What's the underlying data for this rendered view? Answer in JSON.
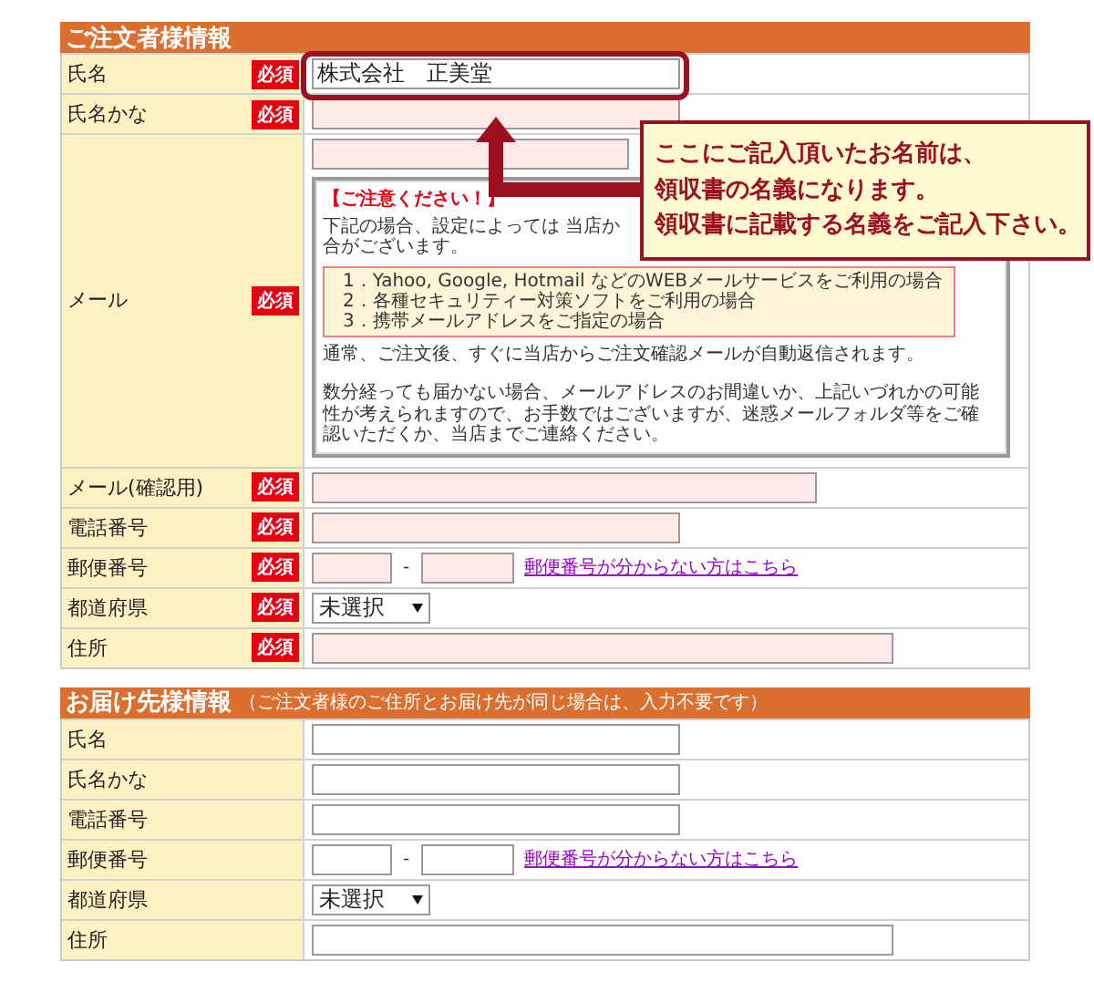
{
  "sections": [
    {
      "title": "ご注文者様情報",
      "rows": [
        {
          "label": "氏名",
          "badge": "必須",
          "kind": "name",
          "value": "株式会社　正美堂",
          "highlighted": true
        },
        {
          "label": "氏名かな",
          "badge": "必須",
          "kind": "name"
        },
        {
          "label": "メール",
          "badge": "必須",
          "kind": "email",
          "notice": {
            "heading": "【ご注意ください！】",
            "lines": [
              "下記の場合、設定によっては 当店か",
              "合がございます。"
            ],
            "list": [
              "1．Yahoo, Google, Hotmail などのWEBメールサービスをご利用の場合",
              "2．各種セキュリティー対策ソフトをご利用の場合",
              "3．携帯メールアドレスをご指定の場合"
            ],
            "paragraphs": [
              "通常、ご注文後、すぐに当店からご注文確認メールが自動返信されます。",
              "数分経っても届かない場合、メールアドレスのお間違いか、上記いづれかの可能性が考えられますので、お手数ではございますが、迷惑メールフォルダ等をご確認いただくか、当店までご連絡ください。"
            ]
          }
        },
        {
          "label": "メール(確認用)",
          "badge": "必須",
          "kind": "wide"
        },
        {
          "label": "電話番号",
          "badge": "必須",
          "kind": "name"
        },
        {
          "label": "郵便番号",
          "badge": "必須",
          "kind": "zip",
          "separator": "-",
          "link": "郵便番号が分からない方はこちら"
        },
        {
          "label": "都道府県",
          "badge": "必須",
          "kind": "select",
          "value": "未選択"
        },
        {
          "label": "住所",
          "badge": "必須",
          "kind": "address"
        }
      ]
    },
    {
      "title": "お届け先様情報",
      "note": "（ご注文者様のご住所とお届け先が同じ場合は、入力不要です）",
      "rows": [
        {
          "label": "氏名",
          "kind": "name"
        },
        {
          "label": "氏名かな",
          "kind": "name"
        },
        {
          "label": "電話番号",
          "kind": "name"
        },
        {
          "label": "郵便番号",
          "kind": "zip",
          "separator": "-",
          "link": "郵便番号が分からない方はこちら"
        },
        {
          "label": "都道府県",
          "kind": "select",
          "value": "未選択"
        },
        {
          "label": "住所",
          "kind": "address"
        }
      ]
    }
  ],
  "callout": {
    "lines": [
      "ここにご記入頂いたお名前は、",
      "領収書の名義になります。",
      "領収書に記載する名義をご記入下さい。"
    ]
  }
}
